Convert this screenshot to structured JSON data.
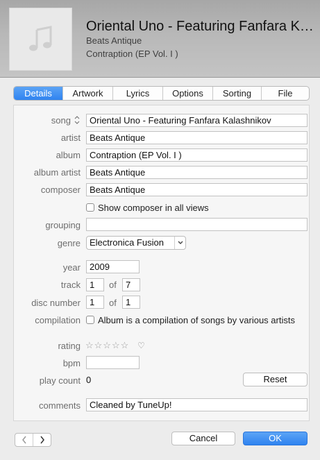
{
  "header": {
    "title": "Oriental Uno - Featuring Fanfara Kalashnikov",
    "artist": "Beats Antique",
    "album": "Contraption (EP Vol. I )"
  },
  "tabs": [
    {
      "label": "Details",
      "active": true
    },
    {
      "label": "Artwork"
    },
    {
      "label": "Lyrics"
    },
    {
      "label": "Options"
    },
    {
      "label": "Sorting"
    },
    {
      "label": "File"
    }
  ],
  "details": {
    "song_label": "song",
    "song_value": "Oriental Uno - Featuring Fanfara Kalashnikov",
    "artist_label": "artist",
    "artist_value": "Beats Antique",
    "album_label": "album",
    "album_value": "Contraption (EP Vol. I )",
    "album_artist_label": "album artist",
    "album_artist_value": "Beats Antique",
    "composer_label": "composer",
    "composer_value": "Beats Antique",
    "show_composer_label": "Show composer in all views",
    "grouping_label": "grouping",
    "grouping_value": "",
    "genre_label": "genre",
    "genre_value": "Electronica Fusion",
    "year_label": "year",
    "year_value": "2009",
    "track_label": "track",
    "track_value": "1",
    "track_of_label": "of",
    "track_total": "7",
    "disc_label": "disc number",
    "disc_value": "1",
    "disc_of_label": "of",
    "disc_total": "1",
    "compilation_label": "compilation",
    "compilation_text": "Album is a compilation of songs by various artists",
    "rating_label": "rating",
    "rating_stars": "☆☆☆☆☆",
    "rating_value": 0,
    "bpm_label": "bpm",
    "bpm_value": "",
    "play_count_label": "play count",
    "play_count_value": "0",
    "reset_label": "Reset",
    "comments_label": "comments",
    "comments_value": "Cleaned by TuneUp!"
  },
  "footer": {
    "cancel_label": "Cancel",
    "ok_label": "OK"
  },
  "colors": {
    "accent": "#2f83f0",
    "header_bg": "#b8b8b8"
  }
}
